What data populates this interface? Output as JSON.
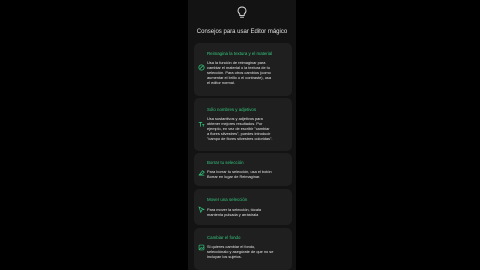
{
  "header": {
    "title": "Consejos para usar Editor mágico",
    "icon": "lightbulb-icon"
  },
  "colors": {
    "accent": "#34c77b",
    "card": "#1f1f20",
    "background": "#131314"
  },
  "tips": [
    {
      "icon": "reimagine-icon",
      "title": "Reimagina la textura y el material",
      "lines": [
        "Usa la función de reimaginar para",
        "cambiar el material o la textura de tu",
        "selección. Para otros cambios (como",
        "aumentar el brillo o el contraste), usa",
        "el editor normal."
      ]
    },
    {
      "icon": "text-format-icon",
      "title": "Sólo nombres y adjetivos",
      "lines": [
        "Usa sustantivos y adjetivos para",
        "obtener mejores resultados. Por",
        "ejemplo, en vez de escribir \"cambiar",
        "a flores silvestres\", puedes introducir",
        "\"campo de flores silvestres coloridas\"."
      ]
    },
    {
      "icon": "eraser-icon",
      "title": "Borrar tu selección",
      "lines": [
        "Para borrar tu selección, usa el botón",
        "Borrar en lugar de Reimaginar."
      ]
    },
    {
      "icon": "move-icon",
      "title": "Mover una selección",
      "lines": [
        "Para mover la selección, tócala",
        "mantenla pulsada y arrástrala"
      ]
    },
    {
      "icon": "background-icon",
      "title": "Cambiar el fondo",
      "lines": [
        "Si quieres cambiar el fondo,",
        "selecciónalo y asegúrate de que no se",
        "incluyan los sujetos."
      ]
    }
  ]
}
